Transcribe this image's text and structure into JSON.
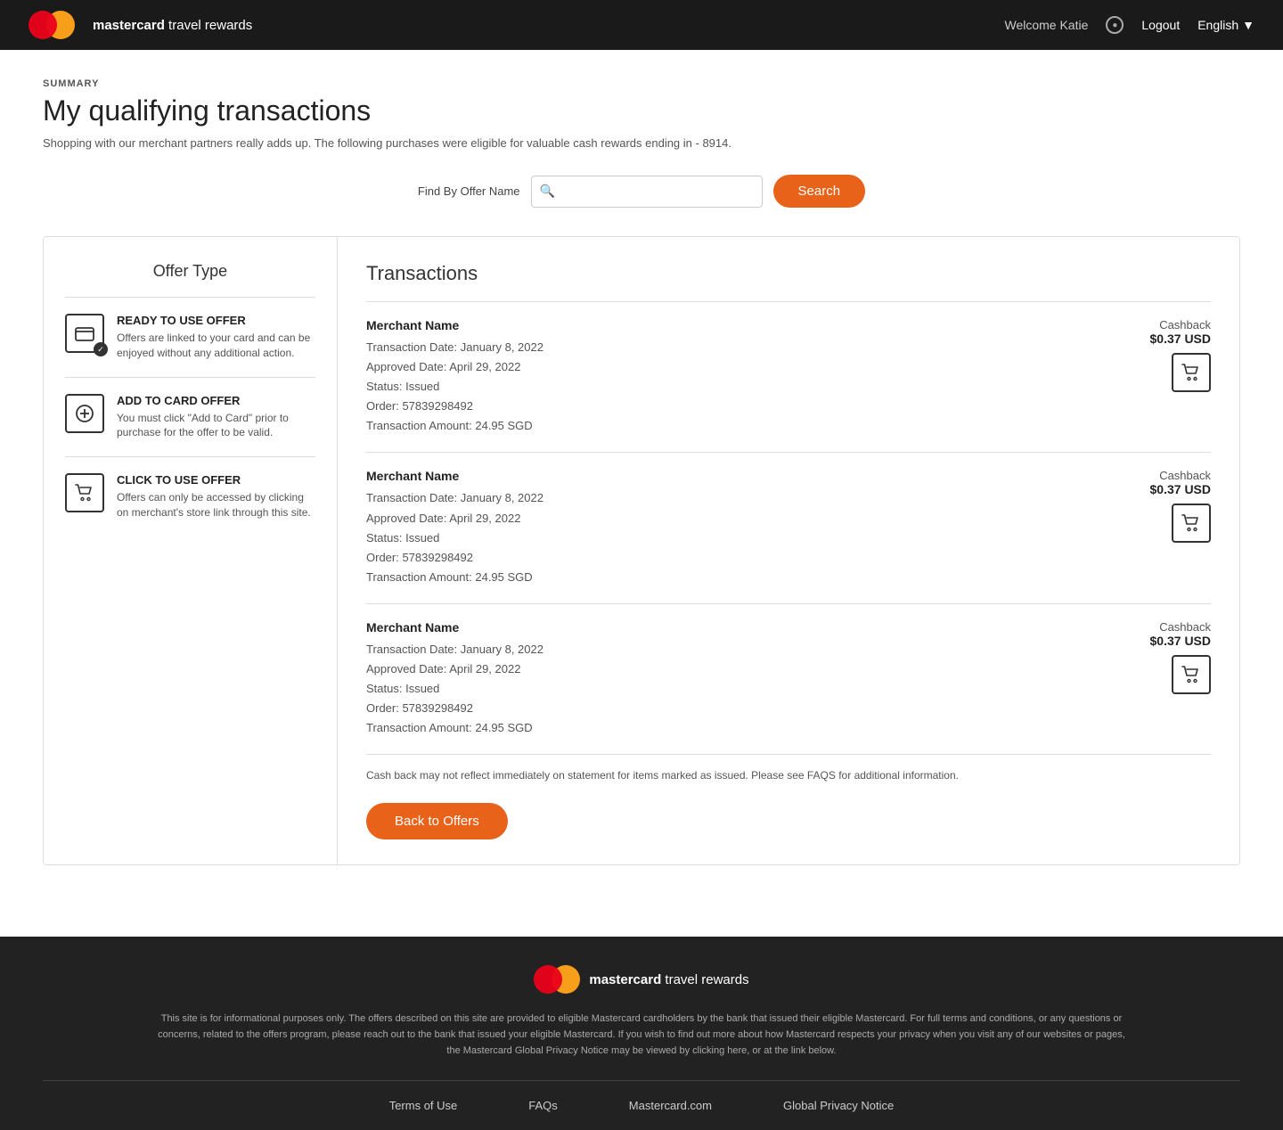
{
  "header": {
    "brand": "mastercard",
    "brand_suffix": " travel rewards",
    "welcome_text": "Welcome Katie",
    "logout_label": "Logout",
    "language_label": "English"
  },
  "page": {
    "summary_label": "SUMMARY",
    "title": "My qualifying transactions",
    "subtitle": "Shopping with our merchant partners really adds up. The following purchases were eligible for valuable cash rewards ending in - 8914."
  },
  "search": {
    "label": "Find By Offer Name",
    "placeholder": "",
    "button_label": "Search"
  },
  "offer_type": {
    "title": "Offer Type",
    "items": [
      {
        "id": "ready-to-use",
        "name": "READY TO USE OFFER",
        "description": "Offers are linked to your card and can be enjoyed without any additional action.",
        "icon_type": "card-check"
      },
      {
        "id": "add-to-card",
        "name": "ADD TO CARD OFFER",
        "description": "You must click \"Add to Card\" prior to purchase for the offer to be valid.",
        "icon_type": "plus"
      },
      {
        "id": "click-to-use",
        "name": "CLICK TO USE OFFER",
        "description": "Offers can only be accessed by clicking on merchant's store link through this site.",
        "icon_type": "cart"
      }
    ]
  },
  "transactions": {
    "title": "Transactions",
    "column_merchant": "Merchant Name",
    "column_cashback": "Cashback",
    "rows": [
      {
        "merchant": "Merchant Name",
        "transaction_date": "Transaction Date: January 8, 2022",
        "approved_date": "Approved Date: April 29, 2022",
        "status": "Status: Issued",
        "order": "Order: 57839298492",
        "amount": "Transaction Amount: 24.95 SGD",
        "cashback_label": "Cashback",
        "cashback_amount": "$0.37 USD"
      },
      {
        "merchant": "Merchant Name",
        "transaction_date": "Transaction Date: January 8, 2022",
        "approved_date": "Approved Date: April 29, 2022",
        "status": "Status: Issued",
        "order": "Order: 57839298492",
        "amount": "Transaction Amount: 24.95 SGD",
        "cashback_label": "Cashback",
        "cashback_amount": "$0.37 USD"
      },
      {
        "merchant": "Merchant Name",
        "transaction_date": "Transaction Date: January 8, 2022",
        "approved_date": "Approved Date: April 29, 2022",
        "status": "Status: Issued",
        "order": "Order: 57839298492",
        "amount": "Transaction Amount: 24.95 SGD",
        "cashback_label": "Cashback",
        "cashback_amount": "$0.37 USD"
      }
    ],
    "cashback_note": "Cash back may not reflect immediately on statement for items marked as issued. Please see FAQS for additional information.",
    "back_button_label": "Back to Offers"
  },
  "footer": {
    "brand": "mastercard",
    "brand_suffix": " travel rewards",
    "disclaimer": "This site is for informational purposes only. The offers described on this site are provided to eligible Mastercard cardholders by the bank that issued their eligible Mastercard. For full terms and conditions, or any questions or concerns, related to the offers program, please reach out to the bank that issued your eligible Mastercard. If you wish to find out more about how Mastercard respects your privacy when you visit any of our websites or pages, the Mastercard Global Privacy Notice may be viewed by clicking here, or at the link below.",
    "links": [
      {
        "label": "Terms of Use"
      },
      {
        "label": "FAQs"
      },
      {
        "label": "Mastercard.com"
      },
      {
        "label": "Global Privacy Notice"
      }
    ]
  }
}
